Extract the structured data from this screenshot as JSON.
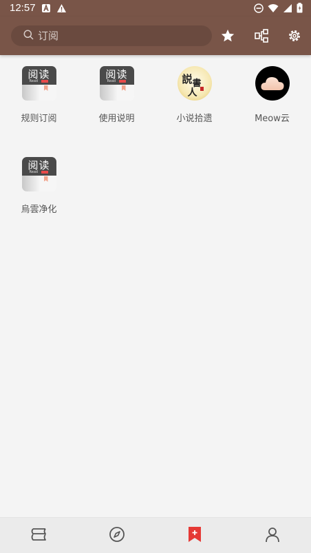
{
  "status_bar": {
    "time": "12:57",
    "left_icons": [
      "a-icon",
      "alert-icon"
    ],
    "right_icons": [
      "dnd-icon",
      "wifi-icon",
      "signal-icon",
      "battery-icon"
    ]
  },
  "app_bar": {
    "search_placeholder": "订阅",
    "actions": [
      "star-icon",
      "group-icon",
      "settings-icon"
    ]
  },
  "sources": [
    {
      "label": "规则订阅",
      "icon": "read-app-logo"
    },
    {
      "label": "使用说明",
      "icon": "read-app-logo"
    },
    {
      "label": "小说拾遗",
      "icon": "story-logo"
    },
    {
      "label": "Meow云",
      "icon": "meow-cloud-logo"
    },
    {
      "label": "烏雲净化",
      "icon": "read-app-logo"
    }
  ],
  "read_logo": {
    "title": "阅读",
    "sub": "Read"
  },
  "story_logo_text": [
    "説",
    "書",
    "人"
  ],
  "bottom_nav": {
    "items": [
      "bookshelf-icon",
      "explore-icon",
      "subscription-icon",
      "profile-icon"
    ],
    "active_index": 2
  },
  "colors": {
    "primary": "#795548",
    "accent": "#e53935",
    "background": "#f4f4f4",
    "nav_icon": "#555555"
  }
}
